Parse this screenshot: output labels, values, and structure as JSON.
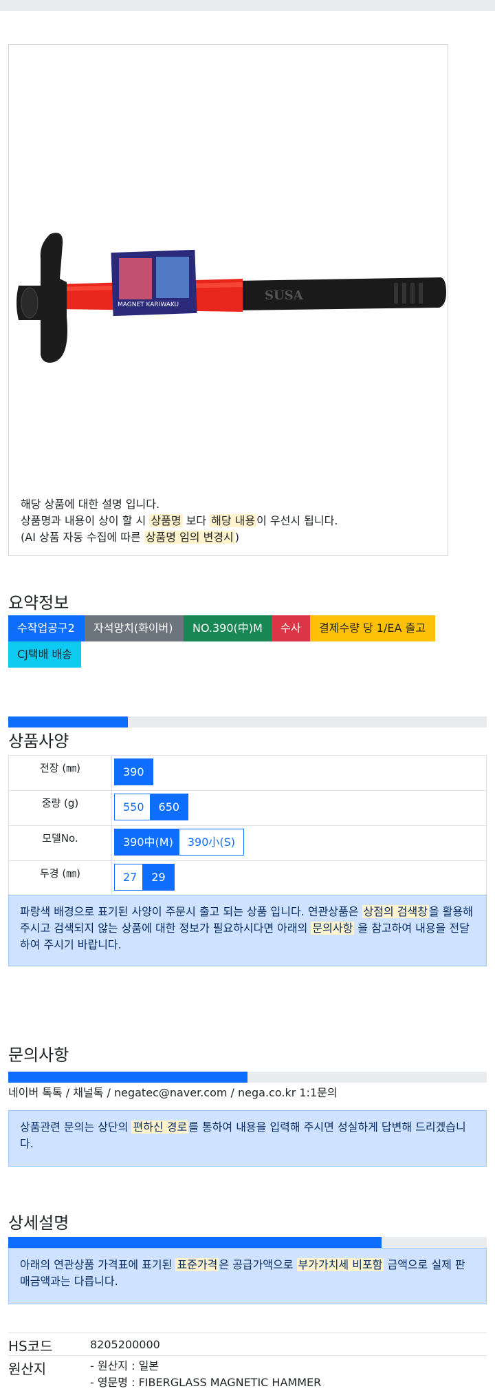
{
  "product": {
    "image_alt": "hammer",
    "desc": {
      "line1": "해당 상품에 대한 설명 입니다.",
      "line2_a": "상품명과 내용이 상이 할 시 ",
      "line2_hl1": "상품명",
      "line2_b": " 보다 ",
      "line2_hl2": "해당 내용",
      "line2_c": "이 우선시 됩니다.",
      "line3_a": "(AI 상품 자동 수집에 따른 ",
      "line3_hl": "상품명 임의 변경시",
      "line3_b": ")"
    }
  },
  "summary": {
    "title": "요약정보",
    "badges": [
      {
        "label": "수작업공구2",
        "color": "#0d6efd"
      },
      {
        "label": "자석망치(화이버)",
        "color": "#6c757d"
      },
      {
        "label": "NO.390(中)M",
        "color": "#198754"
      },
      {
        "label": "수사",
        "color": "#dc3545"
      },
      {
        "label": "결제수량 당 1/EA 출고",
        "color": "#ffc107"
      },
      {
        "label": "CJ택배 배송",
        "color": "#0dcaf0"
      }
    ]
  },
  "spec": {
    "title": "상품사양",
    "progress": 0.25,
    "rows": [
      {
        "label": "전장 (㎜)",
        "options": [
          {
            "text": "390",
            "selected": true
          }
        ]
      },
      {
        "label": "중량 (g)",
        "options": [
          {
            "text": "550",
            "selected": false
          },
          {
            "text": "650",
            "selected": true
          }
        ]
      },
      {
        "label": "모델No.",
        "options": [
          {
            "text": "390中(M)",
            "selected": true
          },
          {
            "text": "390小(S)",
            "selected": false
          }
        ]
      },
      {
        "label": "두경 (㎜)",
        "options": [
          {
            "text": "27",
            "selected": false
          },
          {
            "text": "29",
            "selected": true
          }
        ]
      }
    ],
    "notice": {
      "a": "파랑색 배경으로 표기된 사양이 주문시 출고 되는 상품 입니다. 연관상품은 ",
      "hl1": "상점의 검색창",
      "b": "을 활용해 주시고 검색되지 않는 상품에 대한 정보가 필요하시다면 아래의 ",
      "hl2": "문의사항",
      "c": " 을 참고하여 내용을 전달하여 주시기 바랍니다."
    }
  },
  "inquiry": {
    "title": "문의사항",
    "progress": 0.5,
    "contact": "네이버 톡톡  /  채널톡  /  negatec@naver.com  /  nega.co.kr 1:1문의",
    "notice": {
      "a": "상품관련 문의는 상단의 ",
      "hl": "편하신 경로",
      "b": "를 통하여 내용을 입력해 주시면 성실하게 답변해 드리겠습니다."
    }
  },
  "detail": {
    "title": "상세설명",
    "progress": 0.78,
    "notice": {
      "a": "아래의 연관상품 가격표에 표기된 ",
      "hl1": "표준가격",
      "b": "은 공급가액으로 ",
      "hl2": "부가가치세 비포함",
      "c": " 금액으로 실제 판매금액과는 다릅니다."
    }
  },
  "info": {
    "hs_label": "HS코드",
    "hs_value": "8205200000",
    "origin_label": "원산지",
    "origin_line1": "- 원산지 : 일본",
    "origin_line2": "- 영문명 : FIBERGLASS MAGNETIC HAMMER"
  }
}
